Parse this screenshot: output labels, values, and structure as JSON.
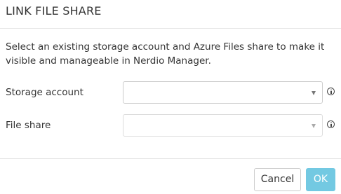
{
  "dialog": {
    "title": "LINK FILE SHARE",
    "description": "Select an existing storage account and Azure Files share to make it visible and manageable in Nerdio Manager."
  },
  "form": {
    "storage_account": {
      "label": "Storage account",
      "value": ""
    },
    "file_share": {
      "label": "File share",
      "value": ""
    }
  },
  "footer": {
    "cancel_label": "Cancel",
    "ok_label": "OK"
  },
  "colors": {
    "ok_button": "#5bc0de",
    "text": "#333333",
    "border": "#cccccc"
  },
  "icons": {
    "info": "info-icon",
    "dropdown": "chevron-down-icon"
  }
}
